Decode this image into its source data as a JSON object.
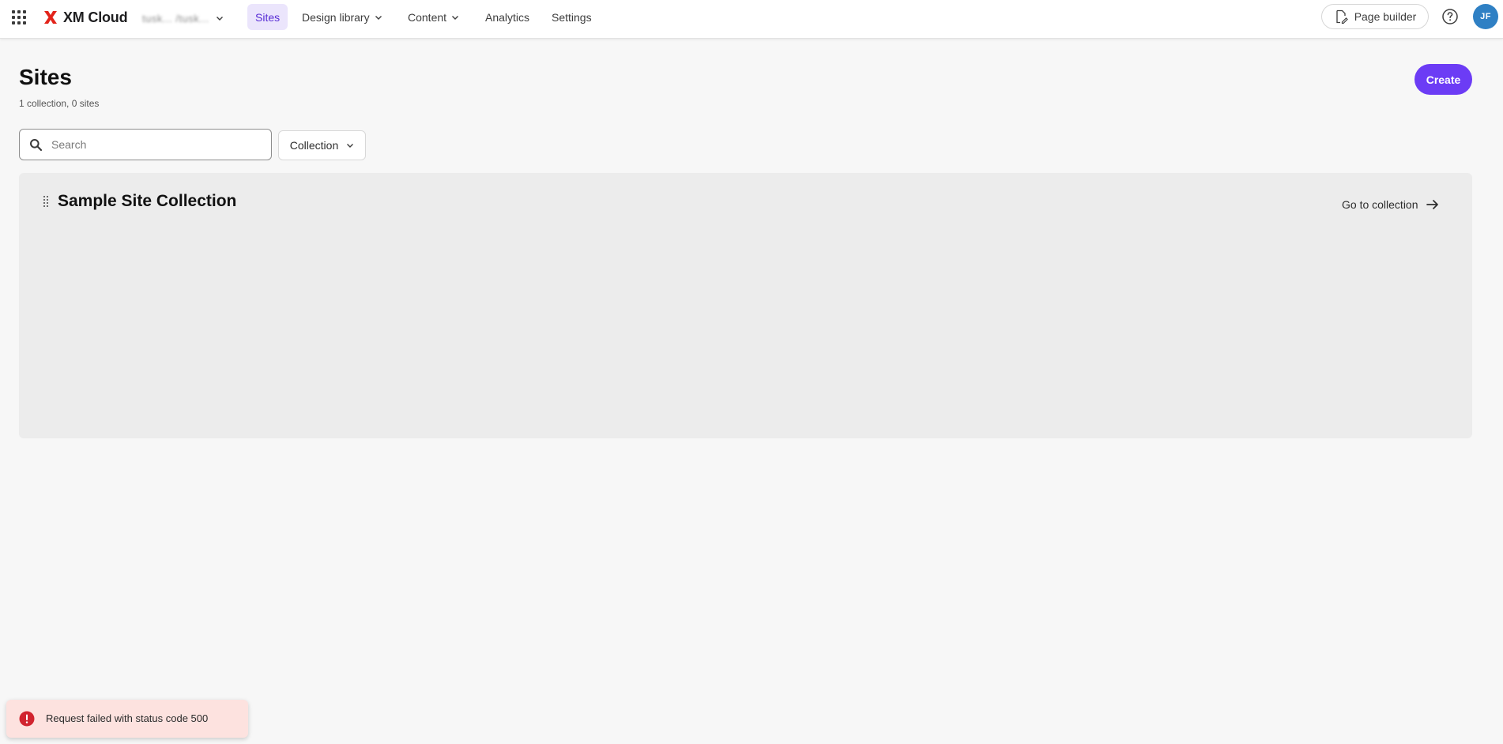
{
  "app": {
    "name": "XM Cloud",
    "environment_label": "tusk... /tusk...",
    "brand_color": "#e2231a",
    "accent_color": "#6c3cf5"
  },
  "nav": {
    "items": [
      {
        "label": "Sites",
        "active": true
      },
      {
        "label": "Design library",
        "has_dropdown": true
      },
      {
        "label": "Content",
        "has_dropdown": true
      },
      {
        "label": "Analytics"
      },
      {
        "label": "Settings"
      }
    ],
    "page_builder_label": "Page builder",
    "help_icon": "help-circle-icon",
    "avatar_initials": "JF"
  },
  "page": {
    "title": "Sites",
    "subtitle": "1 collection, 0 sites",
    "create_label": "Create"
  },
  "filters": {
    "search_placeholder": "Search",
    "search_value": "",
    "collection_label": "Collection"
  },
  "collections": [
    {
      "title": "Sample Site Collection",
      "link_label": "Go to collection"
    }
  ],
  "toast": {
    "type": "error",
    "message": "Request failed with status code 500",
    "color": "#d1242f"
  }
}
